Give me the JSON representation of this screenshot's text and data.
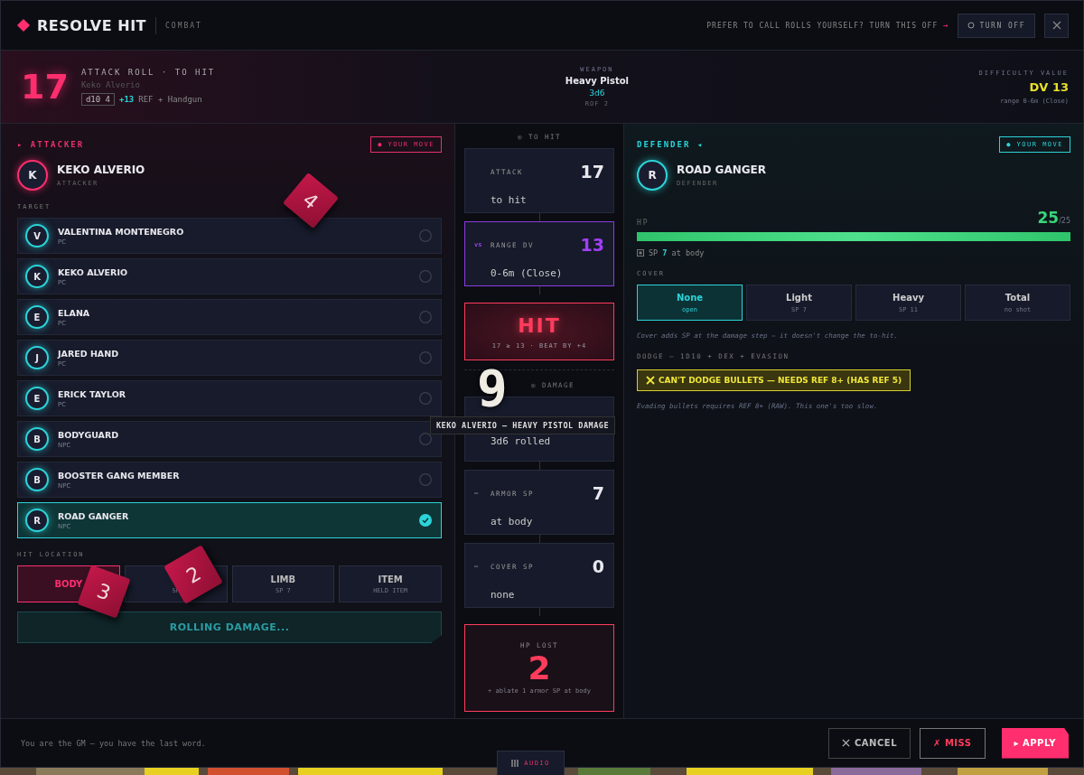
{
  "header": {
    "title": "RESOLVE HIT",
    "tag": "COMBAT",
    "hint": "PREFER TO CALL ROLLS YOURSELF? TURN THIS OFF",
    "hint_arrow": "→",
    "turn_off": "TURN OFF"
  },
  "summary": {
    "total": "17",
    "title": "ATTACK ROLL · TO HIT",
    "attacker": "Keko Alverio",
    "die": "d10 4",
    "bonus": "+13",
    "bonus_note": "REF + Handgun",
    "weapon_label": "WEAPON",
    "weapon": "Heavy Pistol",
    "damage": "3d6",
    "rof": "ROF 2",
    "dv_label": "DIFFICULTY VALUE",
    "dv": "DV 13",
    "dv_note": "range 0-6m (Close)"
  },
  "attacker": {
    "section": "▸ ATTACKER",
    "badge": "● YOUR MOVE",
    "initial": "K",
    "name": "KEKO ALVERIO",
    "role": "ATTACKER",
    "target_label": "TARGET",
    "targets": [
      {
        "initial": "V",
        "name": "VALENTINA MONTENEGRO",
        "type": "PC",
        "selected": false
      },
      {
        "initial": "K",
        "name": "KEKO ALVERIO",
        "type": "PC",
        "selected": false
      },
      {
        "initial": "E",
        "name": "ELANA",
        "type": "PC",
        "selected": false
      },
      {
        "initial": "J",
        "name": "JARED HAND",
        "type": "PC",
        "selected": false
      },
      {
        "initial": "E",
        "name": "ERICK TAYLOR",
        "type": "PC",
        "selected": false
      },
      {
        "initial": "B",
        "name": "BODYGUARD",
        "type": "NPC",
        "selected": false
      },
      {
        "initial": "B",
        "name": "BOOSTER GANG MEMBER",
        "type": "NPC",
        "selected": false
      },
      {
        "initial": "R",
        "name": "ROAD GANGER",
        "type": "NPC",
        "selected": true
      }
    ],
    "hit_location_label": "HIT LOCATION",
    "hit_locations": [
      {
        "label": "BODY",
        "selected": true
      },
      {
        "sub": "SP",
        "selected": false
      },
      {
        "label": "LIMB",
        "sub": "SP 7",
        "selected": false
      },
      {
        "label": "ITEM",
        "sub": "HELD ITEM",
        "selected": false
      }
    ],
    "roll_button": "ROLLING DAMAGE..."
  },
  "resolution": {
    "to_hit_label": "◎ TO HIT",
    "damage_label": "◎ DAMAGE",
    "cards": [
      {
        "kind": "step",
        "label": "ATTACK",
        "value": "17",
        "note": "to hit"
      },
      {
        "kind": "versus",
        "prefix": "vs",
        "label": "RANGE DV",
        "value": "13",
        "note": "0-6m (Close)"
      },
      {
        "kind": "result",
        "value": "HIT",
        "note": "17 ≥ 13 · BEAT BY +4"
      },
      {
        "kind": "divider"
      },
      {
        "kind": "step",
        "note": "3d6 rolled"
      },
      {
        "kind": "step",
        "prefix": "—",
        "label": "ARMOR SP",
        "value": "7",
        "note": "at body"
      },
      {
        "kind": "step",
        "prefix": "—",
        "label": "COVER SP",
        "value": "0",
        "note": "none"
      },
      {
        "kind": "total",
        "label": "HP LOST",
        "value": "2",
        "note": "+ ablate 1 armor SP at body"
      }
    ]
  },
  "defender": {
    "section": "DEFENDER ◂",
    "badge": "● YOUR MOVE",
    "initial": "R",
    "name": "ROAD GANGER",
    "role": "DEFENDER",
    "hp_label": "HP",
    "hp": "25",
    "hp_max": "/25",
    "level": 1,
    "sp_line": "SP **7** at body",
    "cover_label": "COVER",
    "covers": [
      {
        "label": "None",
        "sub": "open",
        "selected": true
      },
      {
        "label": "Light",
        "sub": "SP 7",
        "selected": false
      },
      {
        "label": "Heavy",
        "sub": "SP 11",
        "selected": false
      },
      {
        "label": "Total",
        "sub": "no shot",
        "selected": false
      }
    ],
    "cover_note": "Cover adds SP at the damage step — it doesn't change the to-hit.",
    "dodge_label": "DODGE — 1D10 + DEX + EVASION",
    "warning": "CAN'T DODGE BULLETS — NEEDS REF 8+ (HAS REF 5)",
    "warning_note": "Evading bullets requires REF 8+ (RAW). This one's too slow."
  },
  "footer": {
    "note": "You are the GM — you have the last word.",
    "buttons": [
      {
        "kind": "cancel",
        "label": "CANCEL"
      },
      {
        "kind": "miss",
        "label": "✗ MISS"
      },
      {
        "kind": "apply",
        "label": "▸ APPLY"
      }
    ]
  },
  "audio_tab": "AUDIO",
  "dice": [
    {
      "value": "4"
    },
    {
      "value": "2"
    },
    {
      "value": "3"
    }
  ],
  "roll_result": "9",
  "tooltip": "KEKO ALVERIO — HEAVY PISTOL DAMAGE"
}
